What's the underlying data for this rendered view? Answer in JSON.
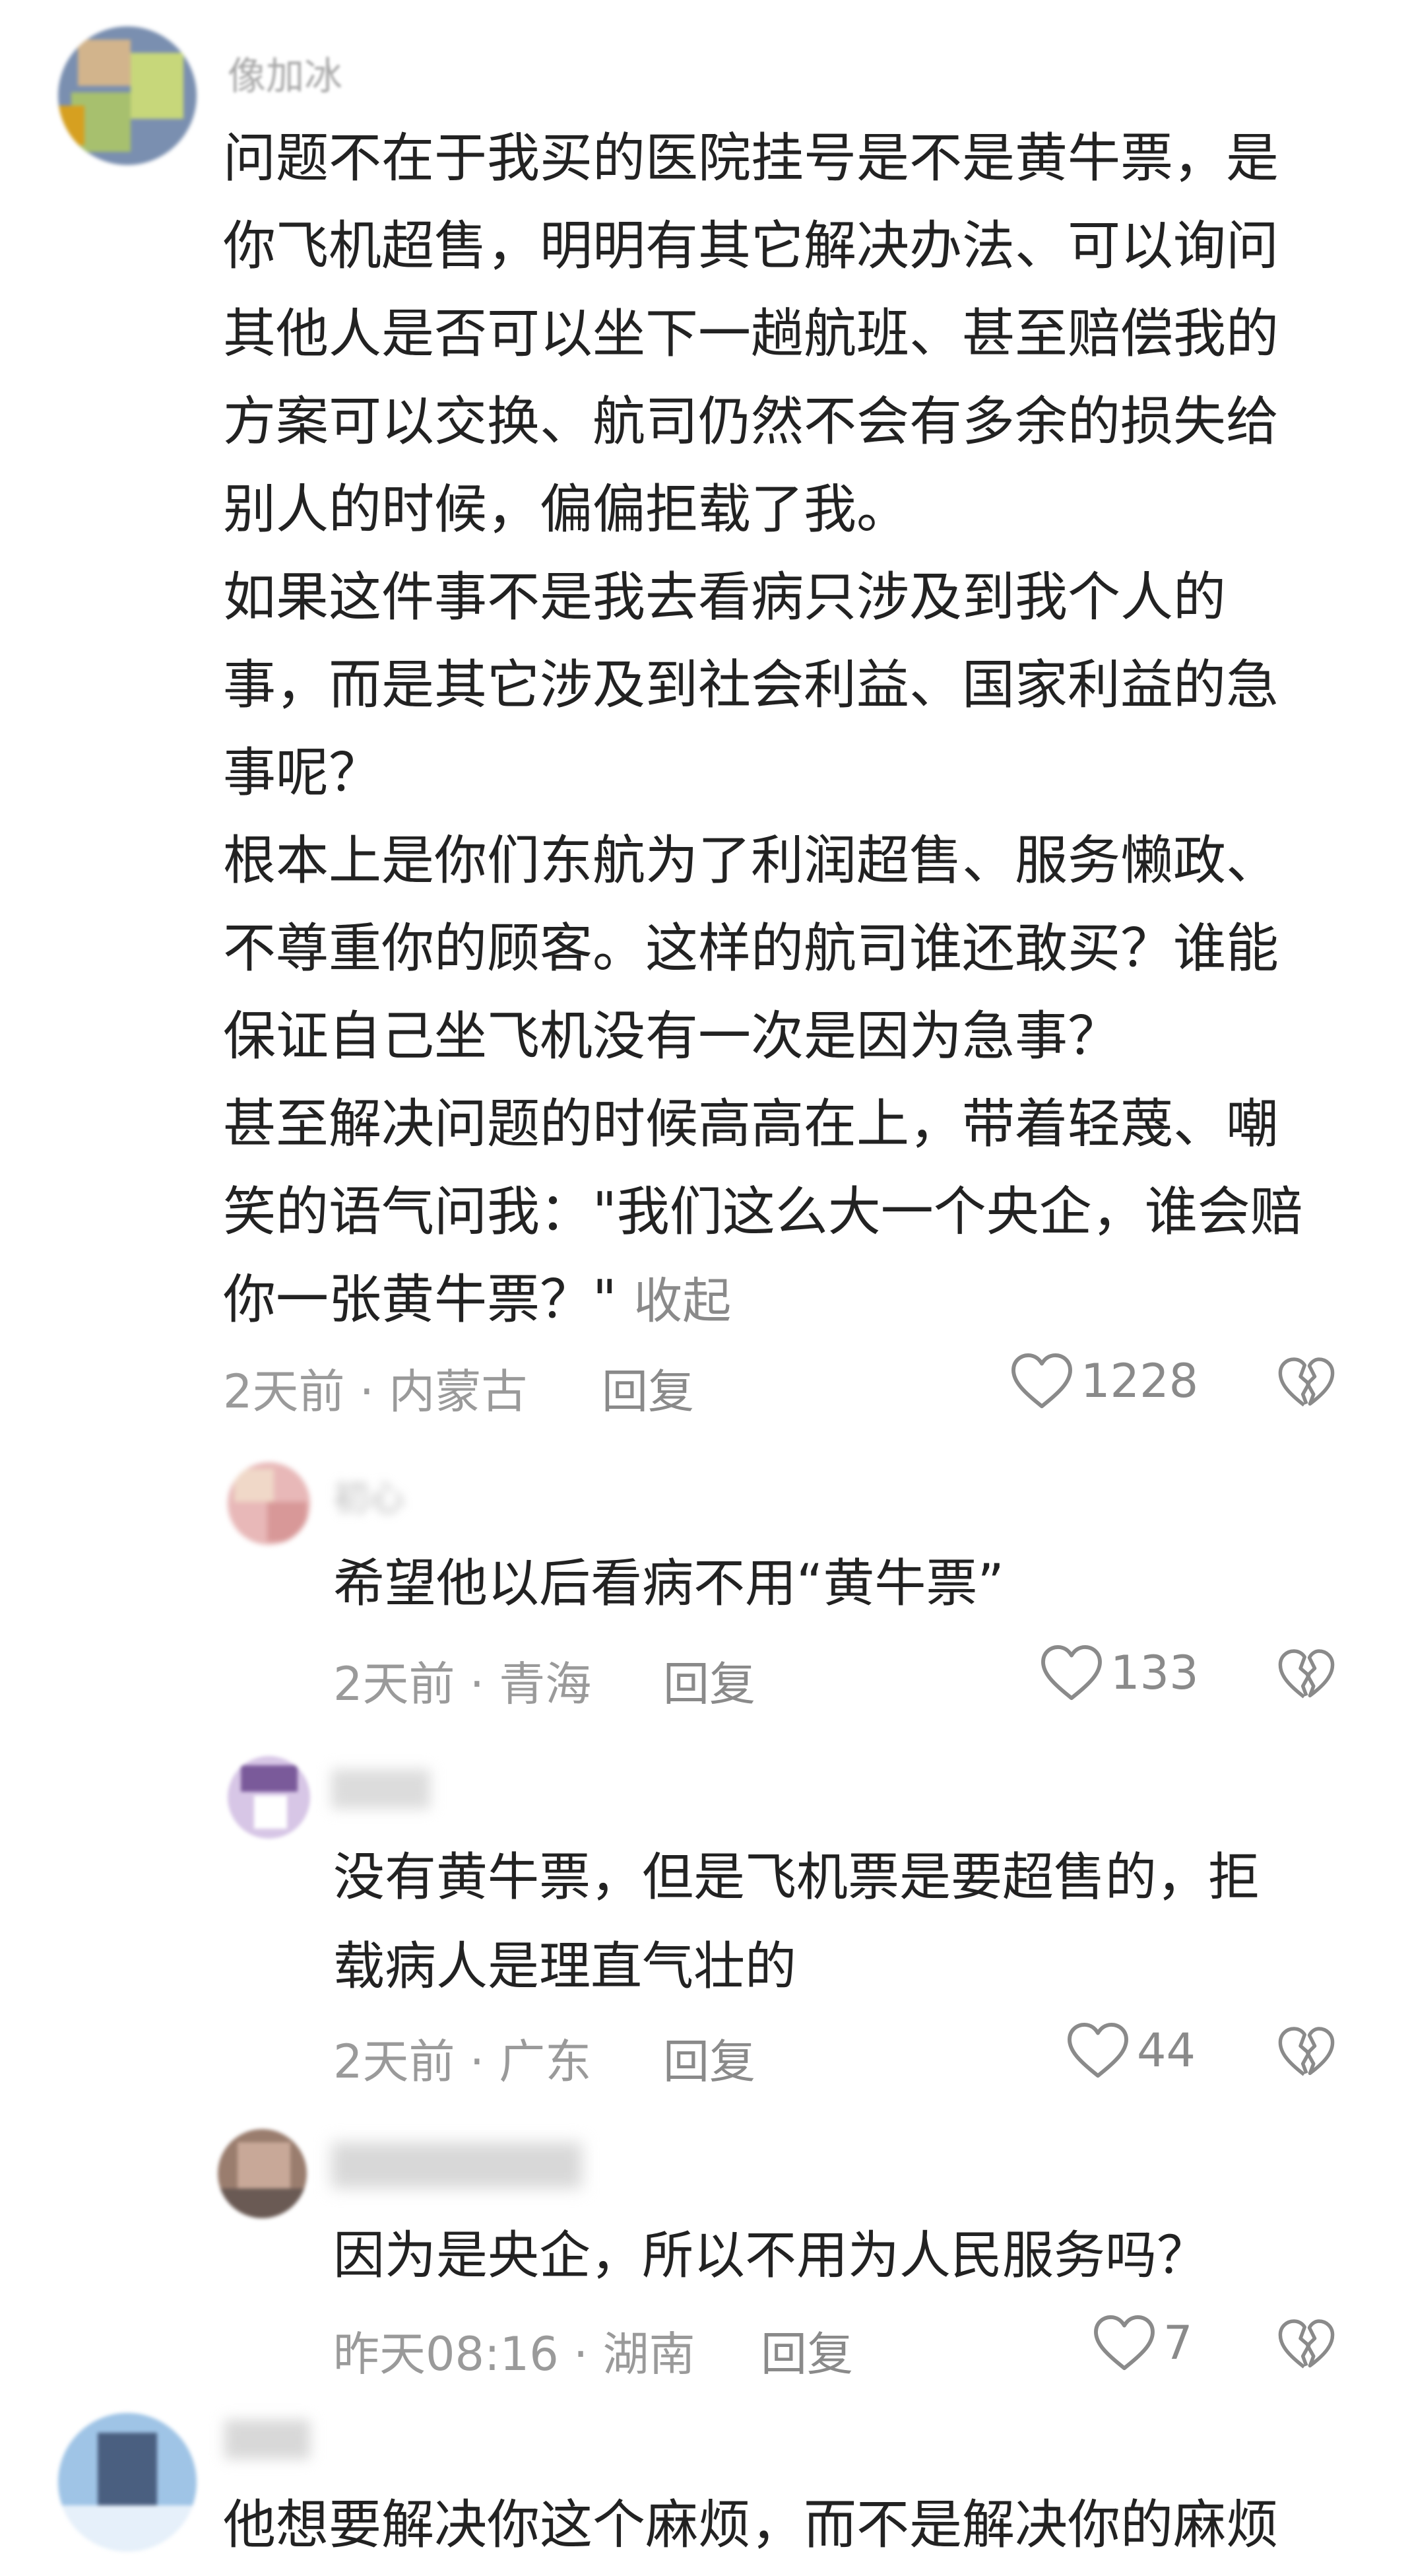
{
  "comments": [
    {
      "username": "像加冰",
      "lines": [
        "问题不在于我买的医院挂号是不是黄牛票，是",
        "你飞机超售，明明有其它解决办法、可以询问",
        "其他人是否可以坐下一趟航班、甚至赔偿我的",
        "方案可以交换、航司仍然不会有多余的损失给",
        "别人的时候，偏偏拒载了我。",
        "如果这件事不是我去看病只涉及到我个人的",
        "事，而是其它涉及到社会利益、国家利益的急",
        "事呢？",
        "根本上是你们东航为了利润超售、服务懒政、",
        "不尊重你的顾客。这样的航司谁还敢买？谁能",
        "保证自己坐飞机没有一次是因为急事？",
        "甚至解决问题的时候高高在上，带着轻蔑、嘲",
        "笑的语气问我：\"我们这么大一个央企，谁会赔",
        "你一张黄牛票？\" "
      ],
      "collapse_label": "收起",
      "meta": "2天前 · 内蒙古",
      "reply_label": "回复",
      "likes": "1228"
    }
  ],
  "replies": [
    {
      "username": "初心",
      "lines": [
        "希望他以后看病不用“黄牛票”"
      ],
      "meta": "2天前 · 青海",
      "reply_label": "回复",
      "likes": "133"
    },
    {
      "username": "",
      "lines": [
        "没有黄牛票，但是飞机票是要超售的，拒",
        "载病人是理直气壮的"
      ],
      "meta": "2天前 · 广东",
      "reply_label": "回复",
      "likes": "44"
    },
    {
      "username": "",
      "lines": [
        "因为是央企，所以不用为人民服务吗？"
      ],
      "meta": "昨天08:16 · 湖南",
      "reply_label": "回复",
      "likes": "7"
    }
  ],
  "last_comment": {
    "username": "",
    "lines": [
      "他想要解决你这个麻烦，而不是解决你的麻烦"
    ]
  },
  "icons": {
    "like": "heart-outline-icon",
    "dislike": "broken-heart-icon"
  },
  "colors": {
    "text": "#222222",
    "meta": "#9a9a9a",
    "icon": "#8a8a8a",
    "background": "#ffffff"
  }
}
